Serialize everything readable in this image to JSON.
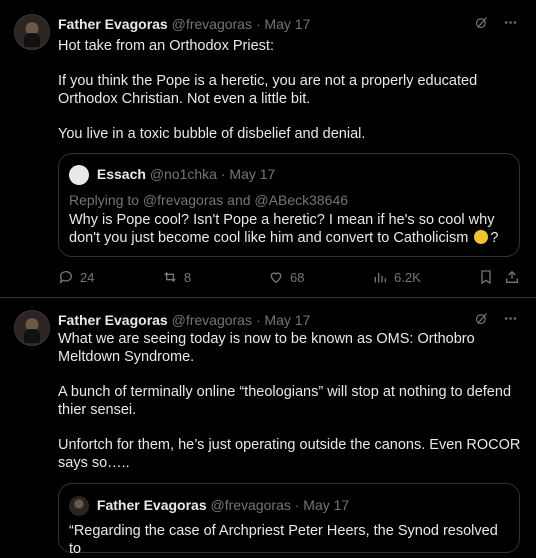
{
  "tweet1": {
    "author_name": "Father Evagoras",
    "handle_date": "@frevagoras · May 17",
    "paragraphs": [
      "Hot take from an Orthodox Priest:",
      "If you think the Pope is a heretic, you are not a properly educated Orthodox Christian. Not even a little bit.",
      "You live in a toxic bubble of disbelief and denial."
    ],
    "quote": {
      "author_name": "Essach",
      "handle_date": "@no1chka · May 17",
      "replying_to": "Replying to @frevagoras and @ABeck38646",
      "text": "Why is Pope cool? Isn't Pope a heretic? I mean if he's so cool why don't you just become cool like him and convert to Catholicism",
      "text_suffix": "?"
    },
    "actions": {
      "replies": "24",
      "reposts": "8",
      "likes": "68",
      "views": "6.2K"
    }
  },
  "tweet2": {
    "author_name": "Father Evagoras",
    "handle_date": "@frevagoras · May 17",
    "paragraphs": [
      "What we are seeing today is now to be known as OMS: Orthobro Meltdown Syndrome.",
      "A bunch of terminally online “theologians” will stop at nothing to defend thier sensei.",
      "Unfortch for them, he’s just operating outside the canons. Even ROCOR says so….."
    ],
    "quote": {
      "author_name": "Father Evagoras",
      "handle_date": "@frevagoras · May 17",
      "text": "“Regarding the case of Archpriest Peter Heers, the Synod resolved to"
    }
  },
  "icons": {
    "grok": "grok-icon",
    "more": "more-icon",
    "reply": "reply-icon",
    "repost": "repost-icon",
    "like": "heart-icon",
    "views": "views-icon",
    "bookmark": "bookmark-icon",
    "share": "share-icon"
  }
}
